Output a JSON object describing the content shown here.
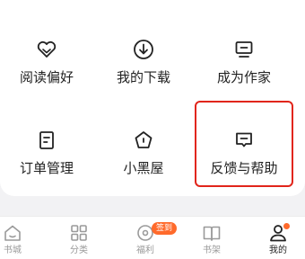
{
  "grid": {
    "items": [
      {
        "label": "阅读偏好",
        "icon": "heart-icon"
      },
      {
        "label": "我的下载",
        "icon": "download-icon"
      },
      {
        "label": "成为作家",
        "icon": "monitor-icon"
      },
      {
        "label": "订单管理",
        "icon": "order-icon"
      },
      {
        "label": "小黑屋",
        "icon": "pentagon-icon"
      },
      {
        "label": "反馈与帮助",
        "icon": "feedback-icon"
      }
    ]
  },
  "tabbar": {
    "items": [
      {
        "label": "书城",
        "icon": "home-icon"
      },
      {
        "label": "分类",
        "icon": "category-icon"
      },
      {
        "label": "福利",
        "icon": "welfare-icon"
      },
      {
        "label": "书架",
        "icon": "bookshelf-icon"
      },
      {
        "label": "我的",
        "icon": "profile-icon",
        "active": true
      }
    ],
    "sign_badge": "签到"
  },
  "colors": {
    "accent": "#ff6a2b",
    "highlight_border": "#e1251b",
    "text_primary": "#222222",
    "text_secondary": "#9a9a9a"
  }
}
